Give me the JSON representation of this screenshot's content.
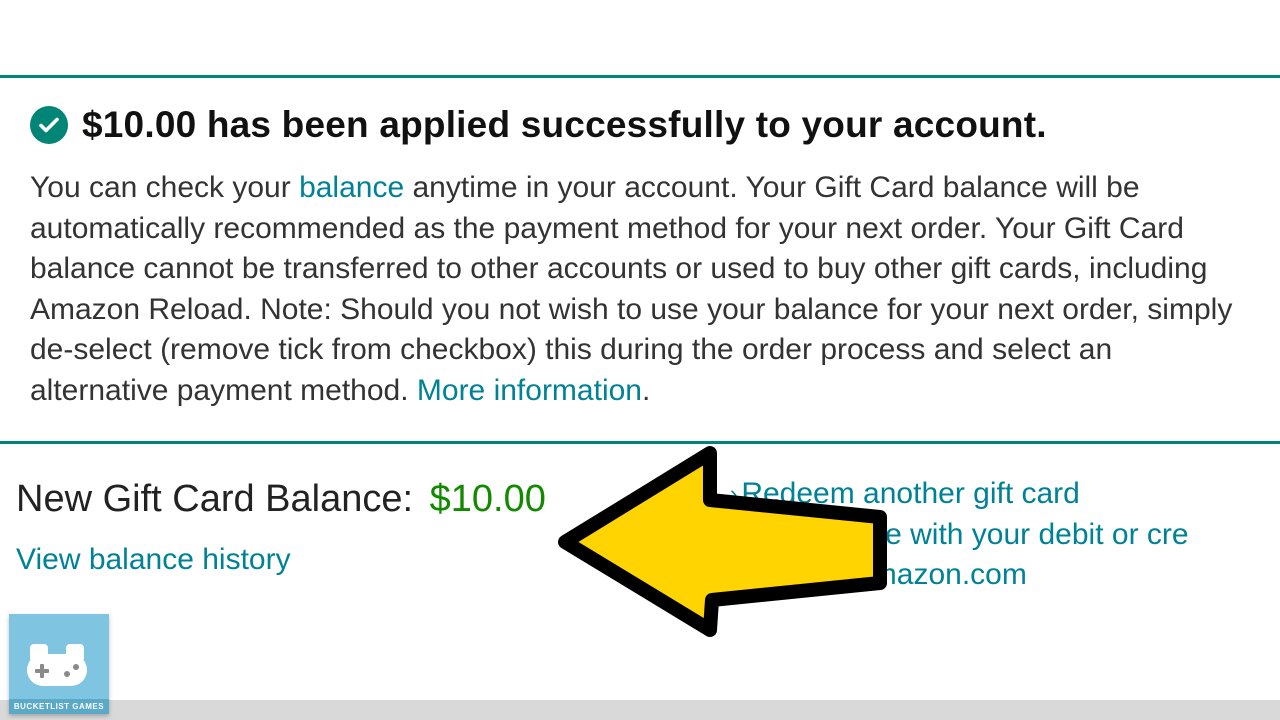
{
  "success": {
    "headline": "$10.00 has been applied successfully to your account.",
    "body_a": "You can check your ",
    "balance_link": "balance",
    "body_b": " anytime in your account. Your Gift Card balance will be automatically recommended as the payment method for your next order. Your Gift Card balance cannot be transferred to other accounts or used to buy other gift cards, including Amazon Reload. Note: Should you not wish to use your balance for your next order, simply de-select (remove tick from checkbox) this during the order process and select an alternative payment method. ",
    "more_info": "More information",
    "period": "."
  },
  "balance": {
    "label": "New Gift Card Balance: ",
    "amount": "$10.00",
    "history": "View balance history"
  },
  "actions": {
    "redeem": "Redeem another gift card",
    "reload_a": "your balance with your debit or cre",
    "shop": "pping on Amazon.com"
  },
  "logo": {
    "label": "BUCKETLIST GAMES"
  }
}
